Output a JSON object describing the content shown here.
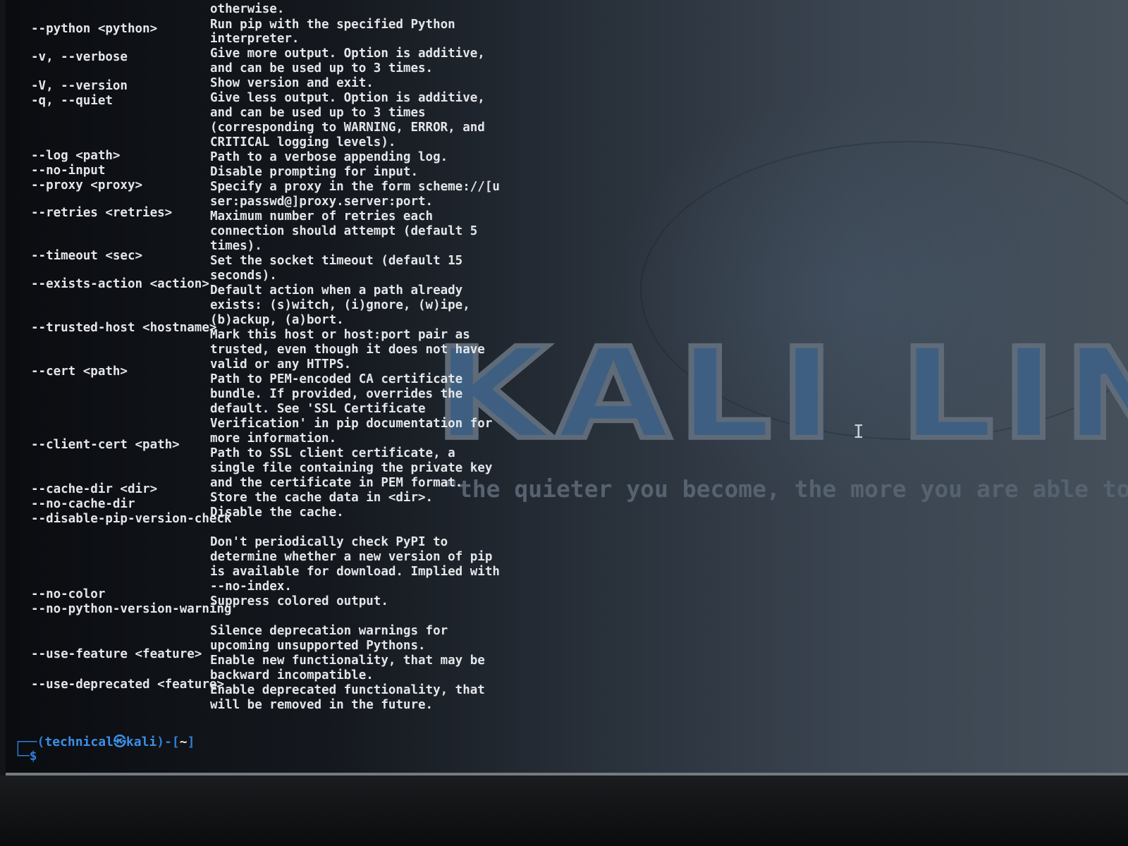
{
  "wallpaper": {
    "logo_text": "KALI LINU",
    "tagline": "\"the quieter you become, the more you are able to"
  },
  "terminal": {
    "options": [
      {
        "opt": "--python <python>"
      },
      {
        "opt": "-v, --verbose"
      },
      {
        "opt": "-V, --version"
      },
      {
        "opt": "-q, --quiet"
      },
      {
        "opt": "--log <path>"
      },
      {
        "opt": "--no-input"
      },
      {
        "opt": "--proxy <proxy>"
      },
      {
        "opt": "--retries <retries>"
      },
      {
        "opt": "--timeout <sec>"
      },
      {
        "opt": "--exists-action <action>"
      },
      {
        "opt": "--trusted-host <hostname>"
      },
      {
        "opt": "--cert <path>"
      },
      {
        "opt": "--client-cert <path>"
      },
      {
        "opt": "--cache-dir <dir>"
      },
      {
        "opt": "--no-cache-dir"
      },
      {
        "opt": "--disable-pip-version-check"
      },
      {
        "opt": "--no-color"
      },
      {
        "opt": "--no-python-version-warning"
      },
      {
        "opt": "--use-feature <feature>"
      },
      {
        "opt": "--use-deprecated <feature>"
      }
    ],
    "desc_lines": [
      "otherwise.",
      "Run pip with the specified Python",
      "interpreter.",
      "Give more output. Option is additive,",
      "and can be used up to 3 times.",
      "Show version and exit.",
      "Give less output. Option is additive,",
      "and can be used up to 3 times",
      "(corresponding to WARNING, ERROR, and",
      "CRITICAL logging levels).",
      "Path to a verbose appending log.",
      "Disable prompting for input.",
      "Specify a proxy in the form scheme://[u",
      "ser:passwd@]proxy.server:port.",
      "Maximum number of retries each",
      "connection should attempt (default 5",
      "times).",
      "Set the socket timeout (default 15",
      "seconds).",
      "Default action when a path already",
      "exists: (s)witch, (i)gnore, (w)ipe,",
      "(b)ackup, (a)bort.",
      "Mark this host or host:port pair as",
      "trusted, even though it does not have",
      "valid or any HTTPS.",
      "Path to PEM-encoded CA certificate",
      "bundle. If provided, overrides the",
      "default. See 'SSL Certificate",
      "Verification' in pip documentation for",
      "more information.",
      "Path to SSL client certificate, a",
      "single file containing the private key",
      "and the certificate in PEM format.",
      "Store the cache data in <dir>.",
      "Disable the cache.",
      "Don't periodically check PyPI to",
      "determine whether a new version of pip",
      "is available for download. Implied with",
      "--no-index.",
      "Suppress colored output.",
      "Silence deprecation warnings for",
      "upcoming unsupported Pythons.",
      "Enable new functionality, that may be",
      "backward incompatible.",
      "Enable deprecated functionality, that",
      "will be removed in the future."
    ],
    "prompt": {
      "open": "┌──(",
      "user_host": "technical㉿kali",
      "close": ")-[",
      "dir": "~",
      "end": "]",
      "symbol": "└─$"
    }
  }
}
